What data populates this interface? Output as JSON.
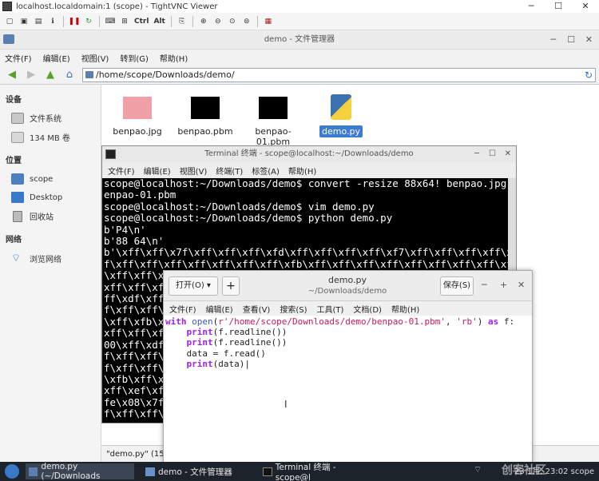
{
  "vnc": {
    "title": "localhost.localdomain:1 (scope) - TightVNC Viewer",
    "toolbar": [
      "Ctrl",
      "Alt"
    ]
  },
  "filemanager": {
    "title": "demo - 文件管理器",
    "menu": [
      "文件(F)",
      "编辑(E)",
      "视图(V)",
      "转到(G)",
      "帮助(H)"
    ],
    "path": "/home/scope/Downloads/demo/",
    "sidebar": {
      "devices_header": "设备",
      "devices": [
        "文件系统",
        "134 MB 卷"
      ],
      "places_header": "位置",
      "places": [
        "scope",
        "Desktop",
        "回收站"
      ],
      "network_header": "网络",
      "network": [
        "浏览网络"
      ]
    },
    "files": [
      {
        "name": "benpao.jpg",
        "selected": false
      },
      {
        "name": "benpao.pbm",
        "selected": false
      },
      {
        "name": "benpao-01.pbm",
        "selected": false
      },
      {
        "name": "demo.py",
        "selected": true
      }
    ],
    "status": "\"demo.py\" (15"
  },
  "terminal": {
    "title": "Terminal 终端 - scope@localhost:~/Downloads/demo",
    "menu": [
      "文件(F)",
      "编辑(E)",
      "视图(V)",
      "终端(T)",
      "标签(A)",
      "帮助(H)"
    ],
    "lines": [
      "scope@localhost:~/Downloads/demo$ convert -resize 88x64! benpao.jpg b",
      "enpao-01.pbm",
      "scope@localhost:~/Downloads/demo$ vim demo.py",
      "scope@localhost:~/Downloads/demo$ python demo.py",
      "b'P4\\n'",
      "b'88 64\\n'",
      "b'\\xff\\xff\\x7f\\xff\\xff\\xff\\xfd\\xff\\xff\\xff\\xff\\xf7\\xff\\xff\\xff\\xff\\xff\\xff\\xf",
      "f\\xff\\xff\\xff\\xff\\xff\\xff\\xff\\xfb\\xff\\xff\\xff\\xff\\xff\\xff\\xff\\xff\\xff\\xff\\xff",
      "\\xff\\xff\\x",
      "xff\\xff\\xf",
      "ff\\xdf\\xff",
      "f\\xff\\xff\\",
      "\\xff\\xfb\\x",
      "xff\\xff\\xf",
      "00\\xff\\xdf",
      "f\\xff\\xff\\",
      "f\\xff\\xff\\",
      "\\xfb\\xff\\x",
      "xff\\xef\\xf",
      "fe\\x08\\x7f",
      "f\\xff\\xff\\"
    ]
  },
  "gedit": {
    "open_label": "打开(O)",
    "new_label": "+",
    "save_label": "保存(S)",
    "title": "demo.py",
    "subtitle": "~/Downloads/demo",
    "menu": [
      "文件(F)",
      "编辑(E)",
      "查看(V)",
      "搜索(S)",
      "工具(T)",
      "文档(D)",
      "帮助(H)"
    ],
    "code": {
      "l1_with": "with",
      "l1_open": "open",
      "l1_p1": "(",
      "l1_str1": "r'/home/scope/Downloads/demo/benpao-01.pbm'",
      "l1_comma": ", ",
      "l1_str2": "'rb'",
      "l1_p2": ") ",
      "l1_as": "as",
      "l1_f": " f:",
      "l2_print": "print",
      "l2_rest": "(f.readline())",
      "l3_print": "print",
      "l3_rest": "(f.readline())",
      "l4": "data = f.read()",
      "l5_print": "print",
      "l5_rest": "(data)"
    }
  },
  "taskbar": {
    "tasks": [
      "demo.py (~/Downloads",
      "demo - 文件管理器",
      "Terminal 终端 - scope@l"
    ],
    "time": "23 1月, 23:02 scope",
    "watermark": "创客社区"
  }
}
